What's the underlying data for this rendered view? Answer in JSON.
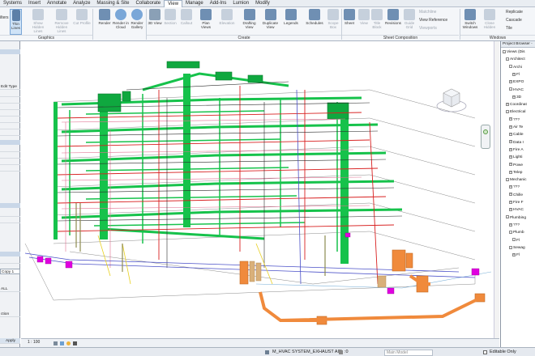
{
  "ribbon_tabs": [
    "Systems",
    "Insert",
    "Annotate",
    "Analyze",
    "Massing & Site",
    "Collaborate",
    "View",
    "Manage",
    "Add-Ins",
    "Lumion",
    "Modify"
  ],
  "active_tab": "View",
  "graphics_group": {
    "label": "Graphics",
    "buttons": [
      {
        "label": "Show Hidden Lines",
        "enabled": false
      },
      {
        "label": "Remove Hidden Lines",
        "enabled": false
      },
      {
        "label": "Cut Profile",
        "enabled": false
      }
    ],
    "thin_lines": "Thin Lines",
    "filters_partial": "ilters"
  },
  "render_buttons": [
    {
      "label": "Render",
      "enabled": true
    },
    {
      "label": "Render in Cloud",
      "enabled": true
    },
    {
      "label": "Render Gallery",
      "enabled": true
    }
  ],
  "create_group": {
    "label": "Create",
    "buttons": [
      {
        "label": "3D View",
        "enabled": true
      },
      {
        "label": "Section",
        "enabled": false
      },
      {
        "label": "Callout",
        "enabled": false
      },
      {
        "label": "Plan Views",
        "enabled": true
      },
      {
        "label": "Elevation",
        "enabled": false
      },
      {
        "label": "Drafting View",
        "enabled": true
      },
      {
        "label": "Duplicate View",
        "enabled": true
      },
      {
        "label": "Legends",
        "enabled": true
      },
      {
        "label": "Schedules",
        "enabled": true
      },
      {
        "label": "Scope Box",
        "enabled": false
      }
    ]
  },
  "sheet_group": {
    "label": "Sheet Composition",
    "buttons": [
      {
        "label": "Sheet",
        "enabled": true
      },
      {
        "label": "View",
        "enabled": false
      },
      {
        "label": "Title Block",
        "enabled": false
      },
      {
        "label": "Revisions",
        "enabled": true
      },
      {
        "label": "Guide Grid",
        "enabled": false
      }
    ],
    "small_items": [
      {
        "label": "Matchline",
        "enabled": false
      },
      {
        "label": "View Reference",
        "enabled": true
      },
      {
        "label": "Viewports",
        "enabled": false
      }
    ]
  },
  "windows_group": {
    "label": "Windows",
    "buttons": [
      {
        "label": "Switch Windows",
        "enabled": true
      },
      {
        "label": "Close Hidden",
        "enabled": false
      }
    ],
    "small_items": [
      "Replicate",
      "Cascade",
      "Tile"
    ]
  },
  "left_panel": {
    "items": [
      "Edit Type",
      "Copy 1",
      "ALL",
      "ction",
      "Apply"
    ]
  },
  "project_browser": {
    "title": "Project Browser - ",
    "items": [
      {
        "label": "Views (Dis",
        "indent": 0,
        "toggle": "-"
      },
      {
        "label": "Architect",
        "indent": 1,
        "toggle": "-"
      },
      {
        "label": "Archi",
        "indent": 2,
        "toggle": "-"
      },
      {
        "label": "Fl",
        "indent": 3,
        "toggle": "+"
      },
      {
        "label": "EXPO",
        "indent": 2,
        "toggle": "+"
      },
      {
        "label": "HVAC",
        "indent": 2,
        "toggle": "-"
      },
      {
        "label": "3D",
        "indent": 3,
        "toggle": "+"
      },
      {
        "label": "Coordinat",
        "indent": 1,
        "toggle": "+"
      },
      {
        "label": "Electrical",
        "indent": 1,
        "toggle": "-"
      },
      {
        "label": "???",
        "indent": 2,
        "toggle": "+"
      },
      {
        "label": "Air Te",
        "indent": 2,
        "toggle": "+"
      },
      {
        "label": "Cable",
        "indent": 2,
        "toggle": "+"
      },
      {
        "label": "Data I",
        "indent": 2,
        "toggle": "+"
      },
      {
        "label": "Fire A",
        "indent": 2,
        "toggle": "+"
      },
      {
        "label": "Lighti",
        "indent": 2,
        "toggle": "+"
      },
      {
        "label": "Powe",
        "indent": 2,
        "toggle": "+"
      },
      {
        "label": "Telep",
        "indent": 2,
        "toggle": "+"
      },
      {
        "label": "Mechanic",
        "indent": 1,
        "toggle": "-"
      },
      {
        "label": "???",
        "indent": 2,
        "toggle": "+"
      },
      {
        "label": "Chille",
        "indent": 2,
        "toggle": "+"
      },
      {
        "label": "Fire F",
        "indent": 2,
        "toggle": "+"
      },
      {
        "label": "HVAC",
        "indent": 2,
        "toggle": "+"
      },
      {
        "label": "Plumbing",
        "indent": 1,
        "toggle": "-"
      },
      {
        "label": "???",
        "indent": 2,
        "toggle": "+"
      },
      {
        "label": "Plumb",
        "indent": 2,
        "toggle": "-"
      },
      {
        "label": "Fl",
        "indent": 3,
        "toggle": "-"
      },
      {
        "label": "Sewag",
        "indent": 2,
        "toggle": "-"
      },
      {
        "label": "Fl",
        "indent": 3,
        "toggle": "+"
      }
    ]
  },
  "view_bar": {
    "scale": "1 : 100"
  },
  "status_bar": {
    "system_name": "M_HVAC SYSTEM_EXHAUST AIR",
    "main_model": "Main Model",
    "editable_only": "Editable Only",
    "zero": ":0"
  },
  "colors": {
    "duct_green": "#16c24b",
    "equipment_magenta": "#e000e0",
    "pipe_orange": "#f08a3c",
    "pipe_red": "#d82020",
    "active_tab": "#ffffff"
  }
}
